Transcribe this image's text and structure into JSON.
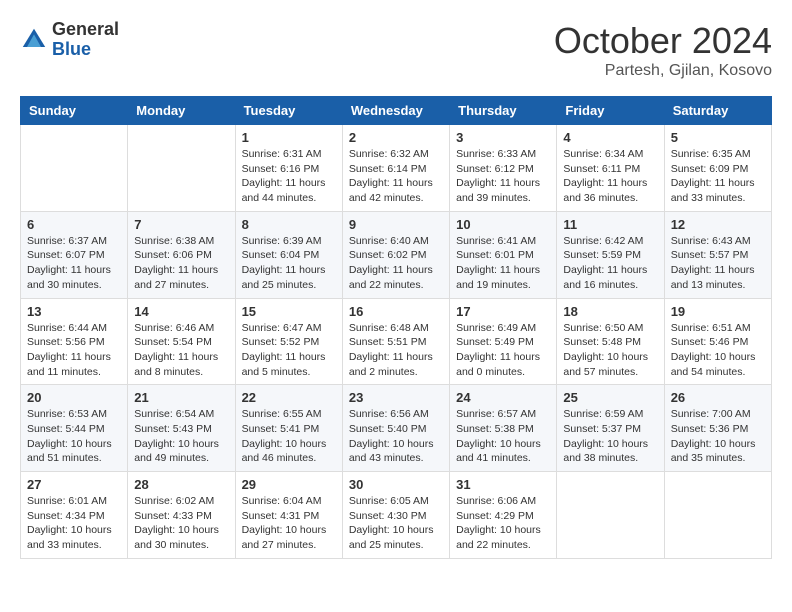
{
  "header": {
    "logo_general": "General",
    "logo_blue": "Blue",
    "month_title": "October 2024",
    "location": "Partesh, Gjilan, Kosovo"
  },
  "weekdays": [
    "Sunday",
    "Monday",
    "Tuesday",
    "Wednesday",
    "Thursday",
    "Friday",
    "Saturday"
  ],
  "weeks": [
    [
      {
        "day": "",
        "details": ""
      },
      {
        "day": "",
        "details": ""
      },
      {
        "day": "1",
        "details": "Sunrise: 6:31 AM\nSunset: 6:16 PM\nDaylight: 11 hours and 44 minutes."
      },
      {
        "day": "2",
        "details": "Sunrise: 6:32 AM\nSunset: 6:14 PM\nDaylight: 11 hours and 42 minutes."
      },
      {
        "day": "3",
        "details": "Sunrise: 6:33 AM\nSunset: 6:12 PM\nDaylight: 11 hours and 39 minutes."
      },
      {
        "day": "4",
        "details": "Sunrise: 6:34 AM\nSunset: 6:11 PM\nDaylight: 11 hours and 36 minutes."
      },
      {
        "day": "5",
        "details": "Sunrise: 6:35 AM\nSunset: 6:09 PM\nDaylight: 11 hours and 33 minutes."
      }
    ],
    [
      {
        "day": "6",
        "details": "Sunrise: 6:37 AM\nSunset: 6:07 PM\nDaylight: 11 hours and 30 minutes."
      },
      {
        "day": "7",
        "details": "Sunrise: 6:38 AM\nSunset: 6:06 PM\nDaylight: 11 hours and 27 minutes."
      },
      {
        "day": "8",
        "details": "Sunrise: 6:39 AM\nSunset: 6:04 PM\nDaylight: 11 hours and 25 minutes."
      },
      {
        "day": "9",
        "details": "Sunrise: 6:40 AM\nSunset: 6:02 PM\nDaylight: 11 hours and 22 minutes."
      },
      {
        "day": "10",
        "details": "Sunrise: 6:41 AM\nSunset: 6:01 PM\nDaylight: 11 hours and 19 minutes."
      },
      {
        "day": "11",
        "details": "Sunrise: 6:42 AM\nSunset: 5:59 PM\nDaylight: 11 hours and 16 minutes."
      },
      {
        "day": "12",
        "details": "Sunrise: 6:43 AM\nSunset: 5:57 PM\nDaylight: 11 hours and 13 minutes."
      }
    ],
    [
      {
        "day": "13",
        "details": "Sunrise: 6:44 AM\nSunset: 5:56 PM\nDaylight: 11 hours and 11 minutes."
      },
      {
        "day": "14",
        "details": "Sunrise: 6:46 AM\nSunset: 5:54 PM\nDaylight: 11 hours and 8 minutes."
      },
      {
        "day": "15",
        "details": "Sunrise: 6:47 AM\nSunset: 5:52 PM\nDaylight: 11 hours and 5 minutes."
      },
      {
        "day": "16",
        "details": "Sunrise: 6:48 AM\nSunset: 5:51 PM\nDaylight: 11 hours and 2 minutes."
      },
      {
        "day": "17",
        "details": "Sunrise: 6:49 AM\nSunset: 5:49 PM\nDaylight: 11 hours and 0 minutes."
      },
      {
        "day": "18",
        "details": "Sunrise: 6:50 AM\nSunset: 5:48 PM\nDaylight: 10 hours and 57 minutes."
      },
      {
        "day": "19",
        "details": "Sunrise: 6:51 AM\nSunset: 5:46 PM\nDaylight: 10 hours and 54 minutes."
      }
    ],
    [
      {
        "day": "20",
        "details": "Sunrise: 6:53 AM\nSunset: 5:44 PM\nDaylight: 10 hours and 51 minutes."
      },
      {
        "day": "21",
        "details": "Sunrise: 6:54 AM\nSunset: 5:43 PM\nDaylight: 10 hours and 49 minutes."
      },
      {
        "day": "22",
        "details": "Sunrise: 6:55 AM\nSunset: 5:41 PM\nDaylight: 10 hours and 46 minutes."
      },
      {
        "day": "23",
        "details": "Sunrise: 6:56 AM\nSunset: 5:40 PM\nDaylight: 10 hours and 43 minutes."
      },
      {
        "day": "24",
        "details": "Sunrise: 6:57 AM\nSunset: 5:38 PM\nDaylight: 10 hours and 41 minutes."
      },
      {
        "day": "25",
        "details": "Sunrise: 6:59 AM\nSunset: 5:37 PM\nDaylight: 10 hours and 38 minutes."
      },
      {
        "day": "26",
        "details": "Sunrise: 7:00 AM\nSunset: 5:36 PM\nDaylight: 10 hours and 35 minutes."
      }
    ],
    [
      {
        "day": "27",
        "details": "Sunrise: 6:01 AM\nSunset: 4:34 PM\nDaylight: 10 hours and 33 minutes."
      },
      {
        "day": "28",
        "details": "Sunrise: 6:02 AM\nSunset: 4:33 PM\nDaylight: 10 hours and 30 minutes."
      },
      {
        "day": "29",
        "details": "Sunrise: 6:04 AM\nSunset: 4:31 PM\nDaylight: 10 hours and 27 minutes."
      },
      {
        "day": "30",
        "details": "Sunrise: 6:05 AM\nSunset: 4:30 PM\nDaylight: 10 hours and 25 minutes."
      },
      {
        "day": "31",
        "details": "Sunrise: 6:06 AM\nSunset: 4:29 PM\nDaylight: 10 hours and 22 minutes."
      },
      {
        "day": "",
        "details": ""
      },
      {
        "day": "",
        "details": ""
      }
    ]
  ]
}
